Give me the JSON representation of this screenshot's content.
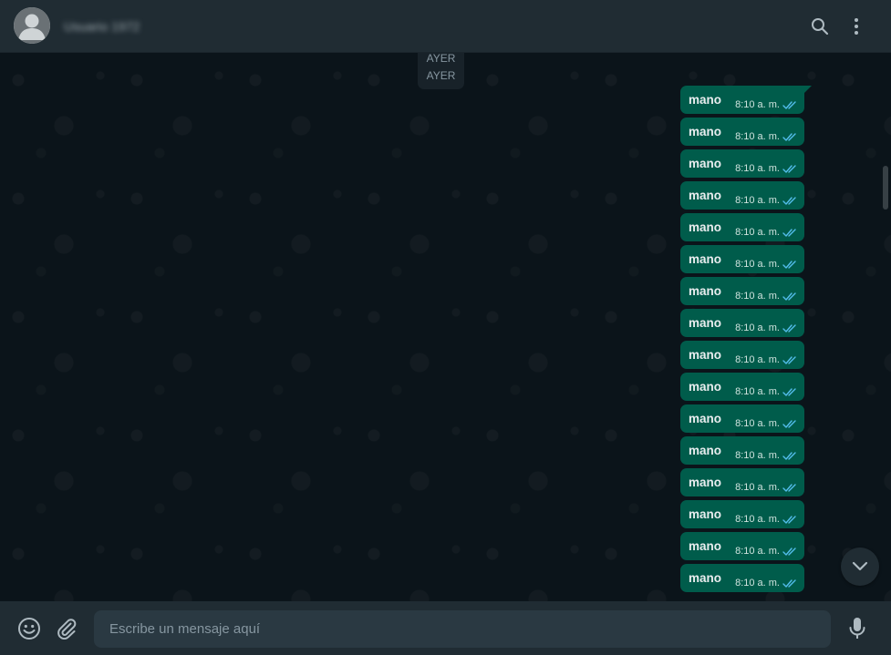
{
  "header": {
    "contact_name": "Usuario 1972",
    "search_icon": "search-icon",
    "menu_icon": "more-vertical-icon"
  },
  "chat": {
    "date_separator": "AYER",
    "date_separator_prev": "AYER",
    "messages": [
      {
        "text": "mano",
        "time": "8:10 a. m.",
        "status": "read"
      },
      {
        "text": "mano",
        "time": "8:10 a. m.",
        "status": "read"
      },
      {
        "text": "mano",
        "time": "8:10 a. m.",
        "status": "read"
      },
      {
        "text": "mano",
        "time": "8:10 a. m.",
        "status": "read"
      },
      {
        "text": "mano",
        "time": "8:10 a. m.",
        "status": "read"
      },
      {
        "text": "mano",
        "time": "8:10 a. m.",
        "status": "read"
      },
      {
        "text": "mano",
        "time": "8:10 a. m.",
        "status": "read"
      },
      {
        "text": "mano",
        "time": "8:10 a. m.",
        "status": "read"
      },
      {
        "text": "mano",
        "time": "8:10 a. m.",
        "status": "read"
      },
      {
        "text": "mano",
        "time": "8:10 a. m.",
        "status": "read"
      },
      {
        "text": "mano",
        "time": "8:10 a. m.",
        "status": "read"
      },
      {
        "text": "mano",
        "time": "8:10 a. m.",
        "status": "read"
      },
      {
        "text": "mano",
        "time": "8:10 a. m.",
        "status": "read"
      },
      {
        "text": "mano",
        "time": "8:10 a. m.",
        "status": "read"
      },
      {
        "text": "mano",
        "time": "8:10 a. m.",
        "status": "read"
      },
      {
        "text": "mano",
        "time": "8:10 a. m.",
        "status": "read"
      }
    ]
  },
  "footer": {
    "placeholder": "Escribe un mensaje aquí",
    "emoji_icon": "emoji-icon",
    "attach_icon": "paperclip-icon",
    "mic_icon": "microphone-icon"
  },
  "colors": {
    "header_bg": "#202c33",
    "chat_bg": "#0b141a",
    "outgoing_bubble": "#005c4b",
    "read_tick": "#53bdeb",
    "icon": "#aebac1"
  }
}
